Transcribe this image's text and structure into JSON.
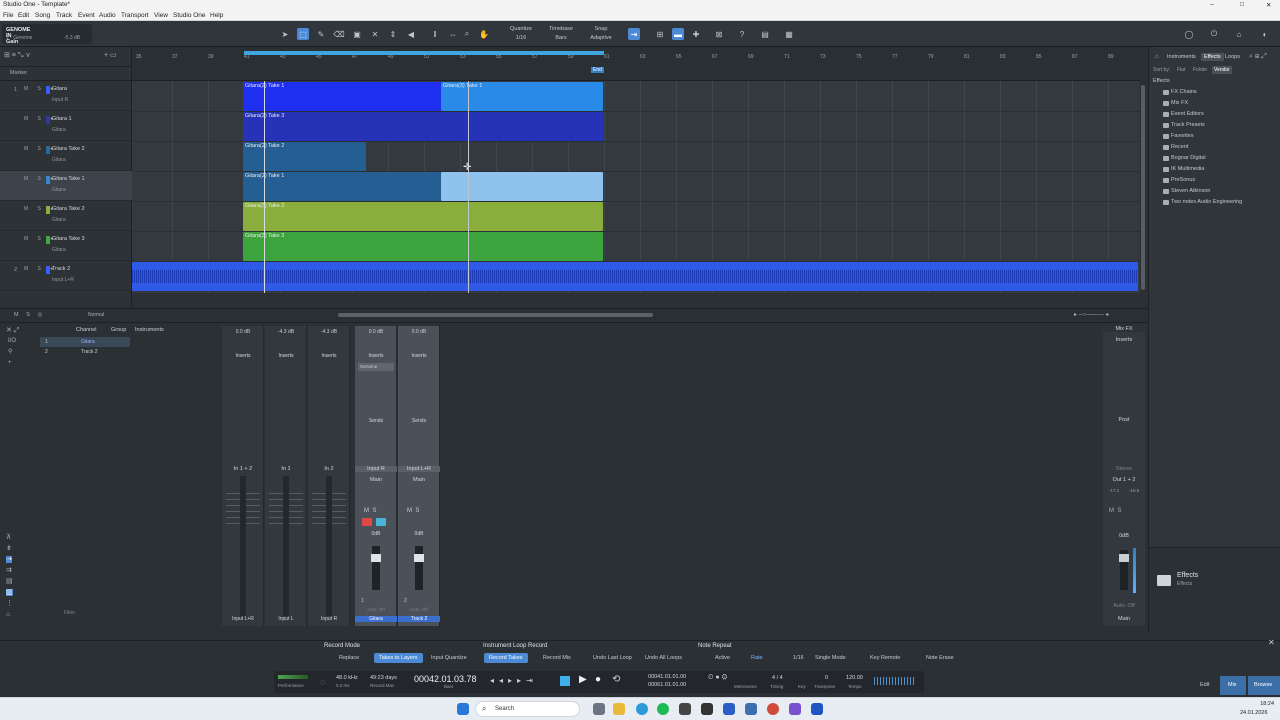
{
  "window": {
    "title": "Studio One - Template*",
    "controls": [
      "–",
      "□",
      "✕"
    ]
  },
  "menu": [
    "File",
    "Edit",
    "Song",
    "Track",
    "Event",
    "Audio",
    "Transport",
    "View",
    "Studio One",
    "Help"
  ],
  "device": {
    "name": "GENOME IN Gain",
    "sub": "1 - Genome",
    "level": "-5.3 dB"
  },
  "toolbar": {
    "quantize_label": "Quantize",
    "quantize_value": "1/16",
    "timebase_label": "Timebase",
    "timebase_value": "Bars",
    "snap_label": "Snap",
    "snap_value": "Adaptive"
  },
  "arrange": {
    "marker_label": "Marker",
    "ruler_numbers": [
      "35",
      "37",
      "39",
      "41",
      "43",
      "45",
      "47",
      "49",
      "51",
      "53",
      "55",
      "57",
      "59",
      "61",
      "63",
      "65",
      "67",
      "69",
      "71",
      "73",
      "75",
      "77",
      "79",
      "81",
      "83",
      "85",
      "87",
      "89"
    ],
    "end_marker": "End"
  },
  "tracks": [
    {
      "idx": "1",
      "name": "Gitara",
      "sub": "Input R",
      "color": "#3d5cff",
      "mode": "Mono"
    },
    {
      "idx": "",
      "name": "Gitara 1",
      "sub": "Gitara",
      "color": "#2d3a9e"
    },
    {
      "idx": "",
      "name": "Gitara Take 2",
      "sub": "Gitara",
      "color": "#2a6a9a"
    },
    {
      "idx": "",
      "name": "Gitara Take 1",
      "sub": "Gitara",
      "color": "#3a86c8"
    },
    {
      "idx": "",
      "name": "Gitara Take 2",
      "sub": "Gitara",
      "color": "#8ab23a"
    },
    {
      "idx": "",
      "name": "Gitara Take 3",
      "sub": "Gitara",
      "color": "#3fa83f"
    },
    {
      "idx": "2",
      "name": "Track 2",
      "sub": "Input L+R",
      "color": "#3d5cff"
    }
  ],
  "clips": [
    {
      "label": "Gitara(2) Take 1",
      "color": "#1e2ff0"
    },
    {
      "label": "Gitara(3) Take 1",
      "color": "#2a8ae8"
    },
    {
      "label": "Gitara(2) Take 3",
      "color": "#2632b8"
    },
    {
      "label": "Gitara(2) Take 2",
      "color": "#245e93"
    },
    {
      "label": "Gitara(2) Take 1",
      "color": "#245e93"
    },
    {
      "label": "Gitara(3) Take 2",
      "color": "#89ae3c"
    },
    {
      "label": "Gitara(3) Take 3",
      "color": "#3da33d"
    }
  ],
  "bottom_arrange": {
    "mode": "Normal"
  },
  "browser": {
    "tabs": [
      "Instruments",
      "Effects",
      "Loops"
    ],
    "sortby": "Sort by:",
    "sort_opts": [
      "Flat",
      "Folder",
      "Vendor"
    ],
    "root": "Effects",
    "items": [
      "FX Chains",
      "Mix FX",
      "Event Editors",
      "Track Presets",
      "Favorites",
      "Recent",
      "Bognar Digital",
      "IK Multimedia",
      "PreSonus",
      "Steven Atkinson",
      "Two notes Audio Engineering"
    ],
    "footer_title": "Effects",
    "footer_sub": "Effects"
  },
  "mixer": {
    "tabs": [
      "Channel",
      "Group",
      "Instruments"
    ],
    "list": [
      {
        "n": "1",
        "name": "Gitara"
      },
      {
        "n": "2",
        "name": "Track 2"
      }
    ],
    "filter": "Filter",
    "strips": [
      {
        "name": "Input L+R",
        "in": "In 1 + 2",
        "db": "0.0 dB"
      },
      {
        "name": "Input L",
        "in": "In 1",
        "db": "-4.3 dB"
      },
      {
        "name": "Input R",
        "in": "In 2",
        "db": "-4.3 dB"
      },
      {
        "name": "Gitara",
        "in": "Input R",
        "out": "Main",
        "db": "0.0 dB",
        "num": "1",
        "vol": "0dB",
        "plugin": "Genome"
      },
      {
        "name": "Track 2",
        "in": "Input L+R",
        "out": "Main",
        "db": "0.0 dB",
        "num": "2",
        "vol": "0dB"
      }
    ],
    "inserts_label": "Inserts",
    "sends_label": "Sends",
    "auto_label": "Auto: Off",
    "main": {
      "name": "Main",
      "out": "Out 1 + 2",
      "mixfx": "Mix FX",
      "post": "Post",
      "vol": "0dB",
      "db": "-17.1",
      "db2": "-16.5",
      "stereo": "Stereo"
    }
  },
  "transport": {
    "record_mode": "Record Mode",
    "rm_buttons": [
      "Replace",
      "Takes to Layers",
      "Input Quantize"
    ],
    "loop_title": "Instrument Loop Record",
    "loop_buttons": [
      "Record Takes",
      "Record Mix"
    ],
    "undo_buttons": [
      "Undo Last Loop",
      "Undo All Loops"
    ],
    "note_repeat": "Note Repeat",
    "nr_buttons": [
      "Active",
      "Rate",
      "1/16",
      "Single Mode",
      "Key Remote",
      "Note Erase"
    ],
    "perf": "Performance",
    "samplerate": "48.0 kHz",
    "latency": "0.2 ms",
    "days": "49:23 days",
    "rec_max": "Record Max",
    "position": "00042.01.03.78",
    "pos_unit": "Bars",
    "loop_l": "00041.01.01.00",
    "loop_r": "00061.01.01.00",
    "metronome": "Metronome",
    "sig": "4 / 4",
    "sig_label": "Timing",
    "key": "Key",
    "transpose": "0",
    "transpose_label": "Transpose",
    "tempo": "120.00",
    "tempo_label": "Tempo",
    "views": [
      "Edit",
      "Mix",
      "Browse"
    ]
  },
  "taskbar": {
    "search": "Search",
    "time": "18:24",
    "date": "24.01.2026"
  }
}
